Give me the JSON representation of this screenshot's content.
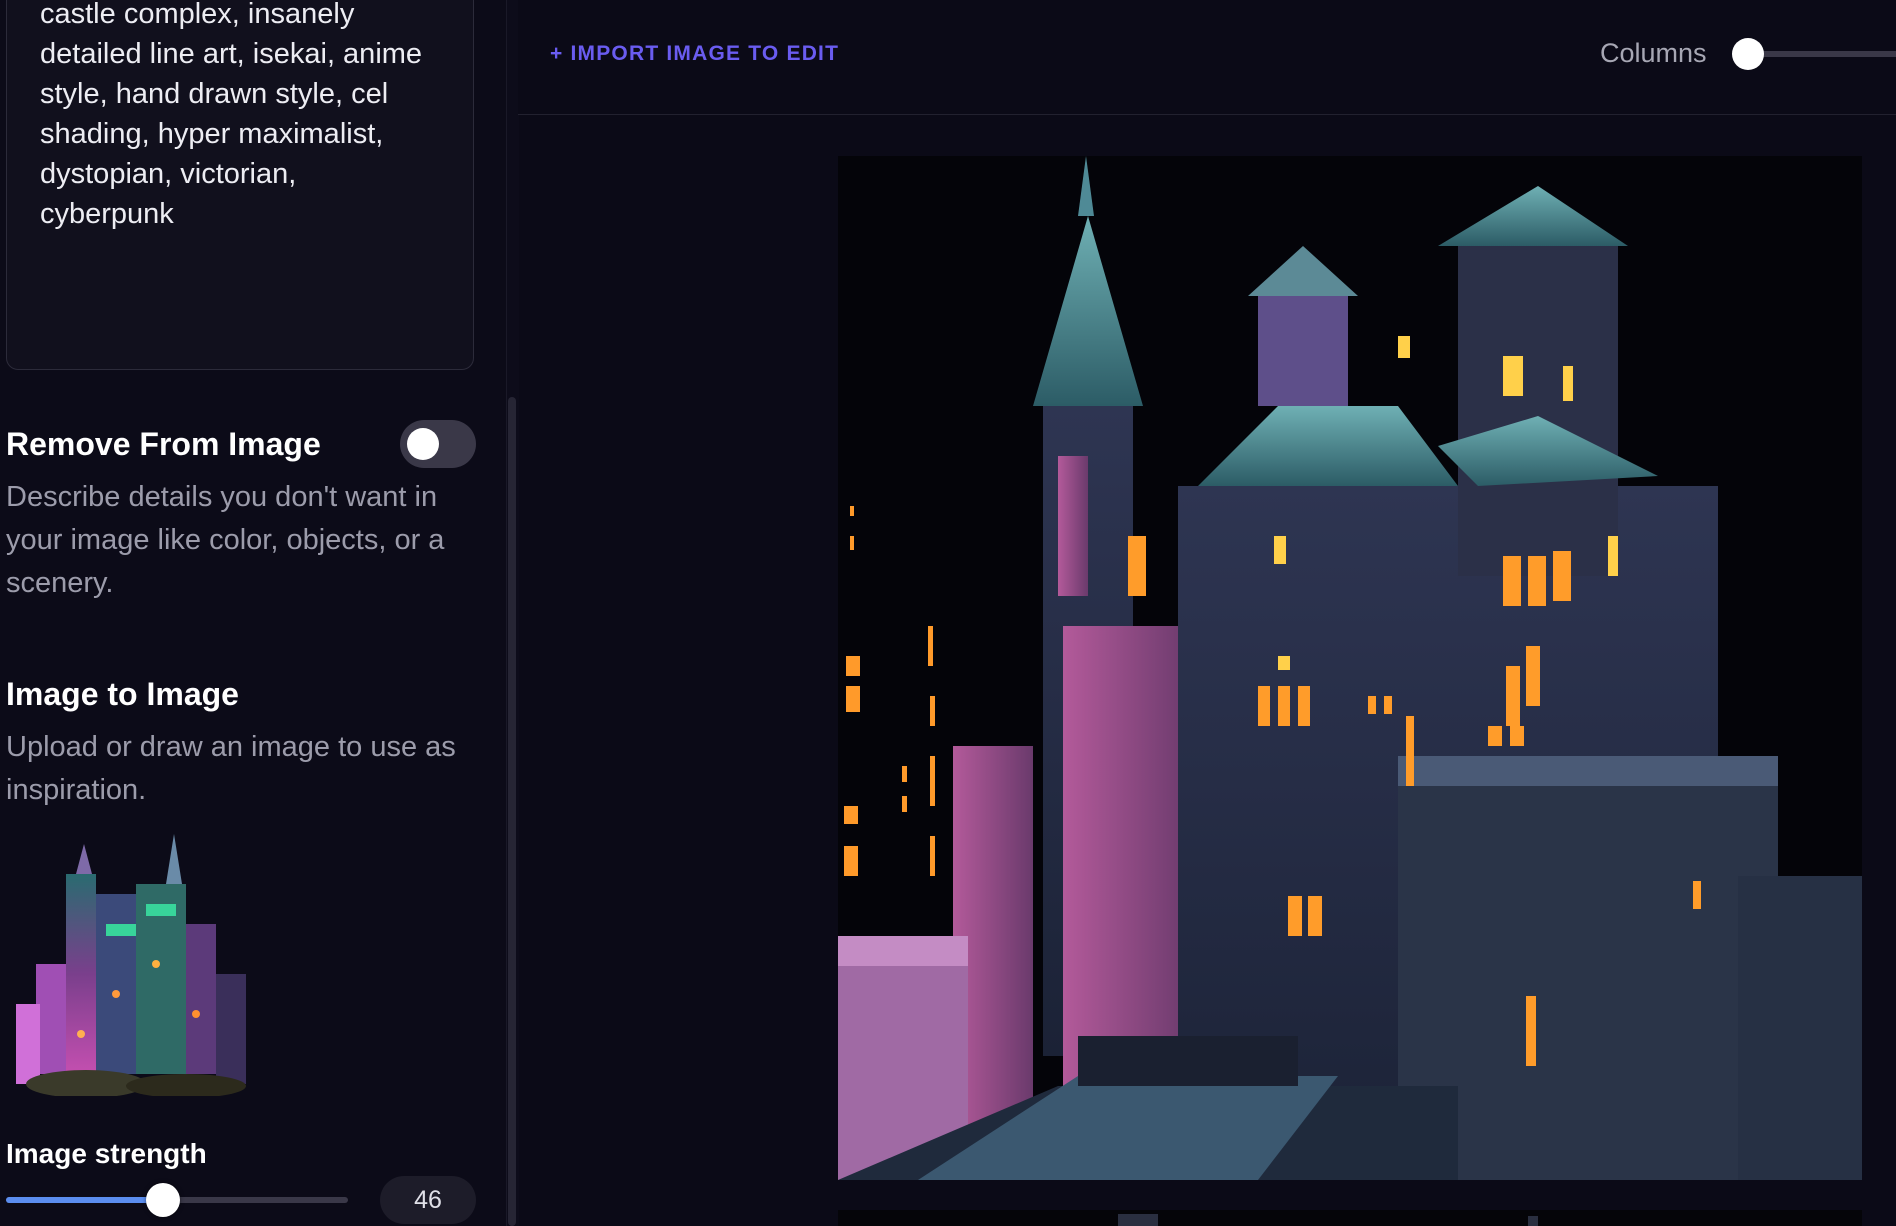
{
  "prompt": {
    "text": "castle complex, insanely\ndetailed line art, isekai, anime\nstyle, hand drawn style, cel\nshading, hyper maximalist,\ndystopian, victorian,\ncyberpunk"
  },
  "remove_from_image": {
    "title": "Remove From Image",
    "description": "Describe details you don't want in your image like color, objects, or a scenery.",
    "enabled": false
  },
  "image_to_image": {
    "title": "Image to Image",
    "description": "Upload or draw an image to use as inspiration."
  },
  "image_strength": {
    "label": "Image strength",
    "value": "46",
    "fraction": 0.46
  },
  "toolbar": {
    "import_label": "+ IMPORT IMAGE TO EDIT",
    "columns_label": "Columns",
    "columns_fraction": 0
  },
  "colors": {
    "accent": "#6a5cf0",
    "slider_fill": "#5b8def",
    "background": "#0b0a17"
  },
  "icons": [
    "toggle-switch",
    "slider-handle"
  ]
}
